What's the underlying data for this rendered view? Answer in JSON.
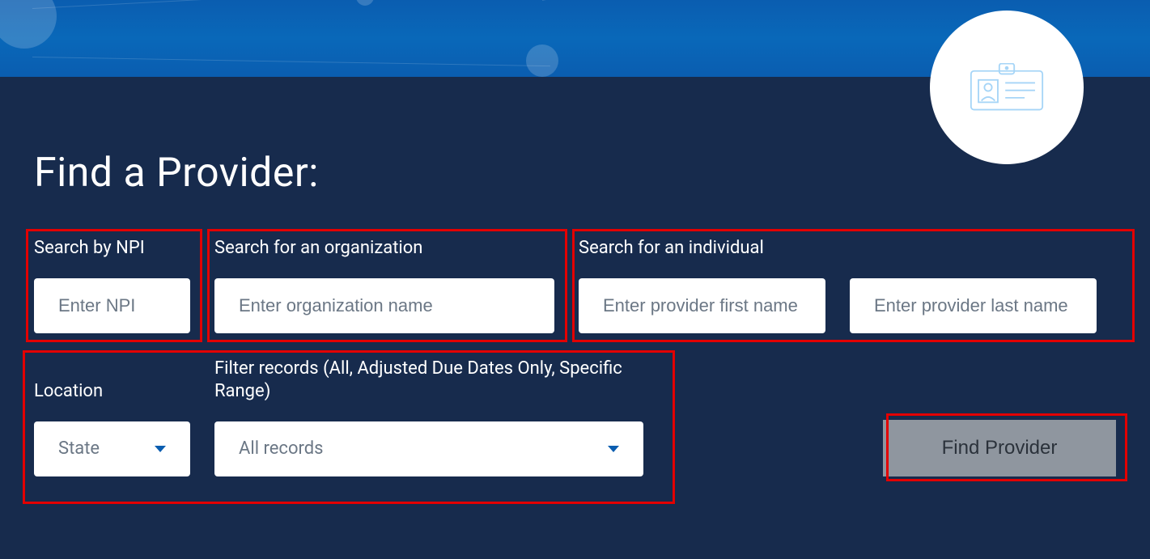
{
  "heading": "Find a Provider:",
  "labels": {
    "npi": "Search by NPI",
    "org": "Search for an organization",
    "individual": "Search for an individual",
    "location": "Location",
    "filter": "Filter records (All, Adjusted Due Dates Only, Specific Range)"
  },
  "placeholders": {
    "npi": "Enter NPI",
    "org": "Enter organization name",
    "first": "Enter provider first name",
    "last": "Enter provider last name"
  },
  "selects": {
    "state": "State",
    "filter": "All records"
  },
  "button": {
    "submit": "Find Provider"
  }
}
